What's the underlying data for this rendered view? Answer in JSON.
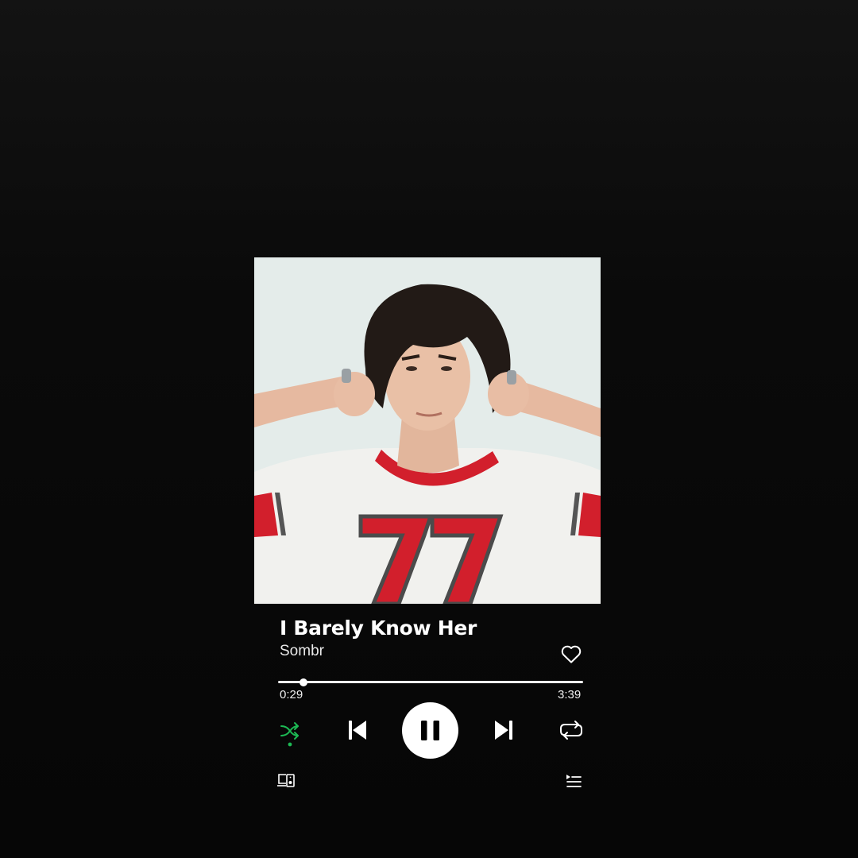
{
  "track": {
    "title": "I Barely Know Her",
    "artist": "Sombr",
    "liked": false
  },
  "progress": {
    "elapsed": "0:29",
    "duration": "3:39",
    "fraction": 0.0845
  },
  "controls": {
    "shuffle_active": true,
    "state": "playing"
  },
  "colors": {
    "accent": "#1db954",
    "background": "#0b0b0b",
    "foreground": "#ffffff"
  },
  "icons": {
    "like": "heart-icon",
    "shuffle": "shuffle-icon",
    "previous": "skip-previous-icon",
    "play_pause": "pause-icon",
    "next": "skip-next-icon",
    "repeat": "repeat-icon",
    "devices": "connect-devices-icon",
    "queue": "queue-icon"
  }
}
